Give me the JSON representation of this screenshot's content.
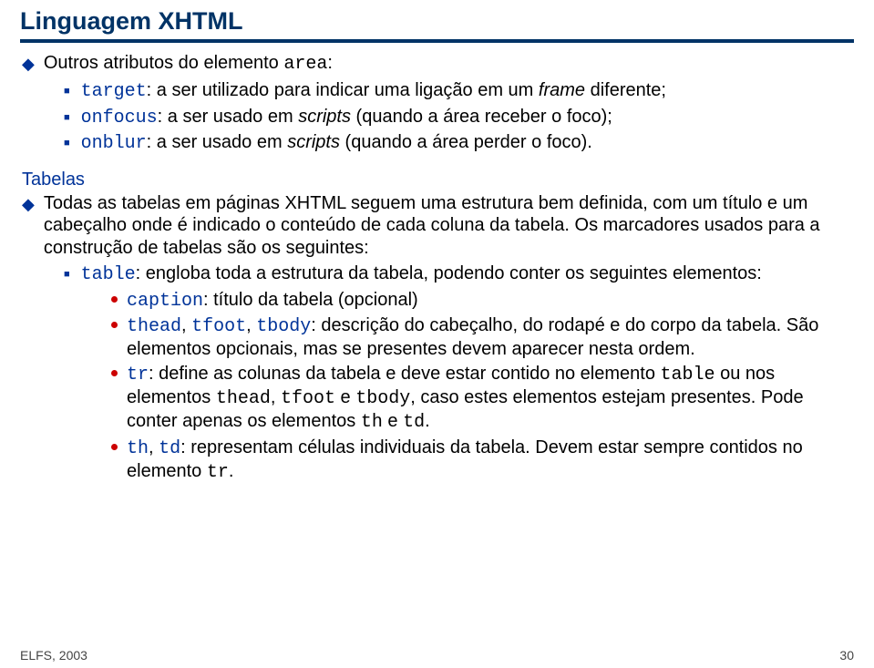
{
  "title": "Linguagem XHTML",
  "intro": {
    "prefix": "Outros atributos do elemento ",
    "elem": "area",
    "suffix": ":"
  },
  "attrs": {
    "target": {
      "kw": "target",
      "colon": ": a ser utilizado para indicar uma ligação em um ",
      "frame": "frame",
      "tail": " diferente;"
    },
    "onfocus": {
      "kw": "onfocus",
      "colon": ": a ser usado em ",
      "scripts": "scripts",
      "tail": " (quando a área receber o foco);"
    },
    "onblur": {
      "kw": "onblur",
      "colon": ": a ser usado em ",
      "scripts": "scripts",
      "tail": " (quando a área perder o foco)."
    }
  },
  "section_title": "Tabelas",
  "para": "Todas as tabelas em páginas XHTML seguem uma estrutura bem definida, com um título e um cabeçalho onde é indicado o conteúdo de cada coluna da tabela. Os marcadores usados para a construção de tabelas são os seguintes:",
  "table_item": {
    "kw": "table",
    "rest": ": engloba toda a estrutura da tabela, podendo conter os seguintes elementos:"
  },
  "sub": {
    "caption": {
      "kw": "caption",
      "rest": ": título da tabela (opcional)"
    },
    "thead_tfoot_tbody": {
      "k1": "thead",
      "c1": ", ",
      "k2": "tfoot",
      "c2": ", ",
      "k3": "tbody",
      "rest": ": descrição do cabeçalho, do rodapé e do corpo da tabela. São elementos opcionais, mas se presentes devem aparecer nesta ordem."
    },
    "tr": {
      "kw": "tr",
      "p1": ": define as colunas da tabela e deve estar contido no elemento ",
      "table": "table",
      "p2": " ou nos elementos ",
      "thead": "thead",
      "p3": ", ",
      "tfoot": "tfoot",
      "p4": " e ",
      "tbody": "tbody",
      "p5": ", caso estes elementos estejam presentes. Pode conter apenas os elementos ",
      "th": "th",
      "p6": " e ",
      "td": "td",
      "p7": "."
    },
    "th_td": {
      "k1": "th",
      "c1": ", ",
      "k2": "td",
      "p1": ": representam células individuais da tabela. Devem estar sempre contidos no elemento ",
      "tr": "tr",
      "p2": "."
    }
  },
  "footer": {
    "left": "ELFS, 2003",
    "right": "30"
  }
}
